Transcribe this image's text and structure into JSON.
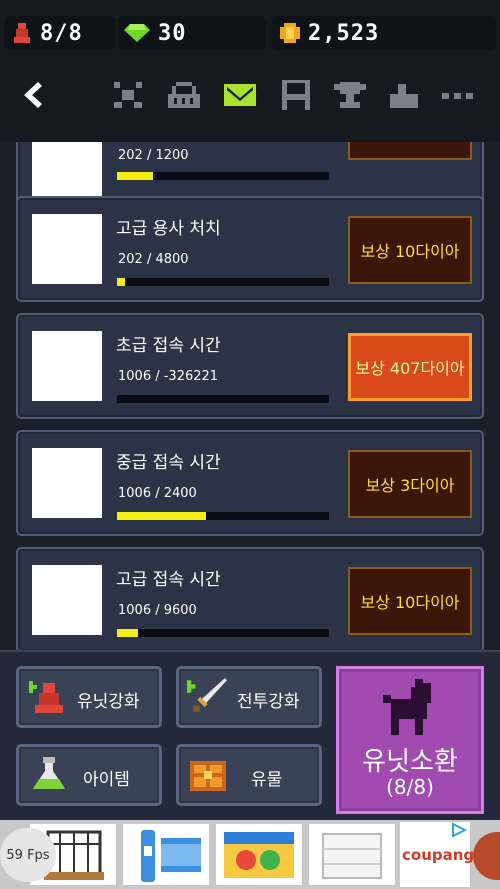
{
  "header": {
    "units_count": "8/8",
    "gems": "30",
    "gold": "2,523"
  },
  "nav": {
    "back_icon": "back-arrow-icon",
    "tabs": [
      "crossed-swords-icon",
      "shop-basket-icon",
      "mail-icon",
      "save-icon",
      "trophy-icon",
      "profile-icon",
      "more-icon"
    ],
    "active_tab": "mail-icon",
    "active_color": "#a6e22e"
  },
  "missions": [
    {
      "title": "",
      "progress_text": "202 / 1200",
      "progress": 0.17,
      "reward": ""
    },
    {
      "title": "고급 용사 처치",
      "progress_text": "202 / 4800",
      "progress": 0.04,
      "reward": "보상 10다이아"
    },
    {
      "title": "초급 접속 시간",
      "progress_text": "1006 / -326221",
      "progress": 0.0,
      "reward": "보상 407다이아",
      "active": true
    },
    {
      "title": "중급 접속 시간",
      "progress_text": "1006 / 2400",
      "progress": 0.42,
      "reward": "보상 3다이아"
    },
    {
      "title": "고급 접속 시간",
      "progress_text": "1006 / 9600",
      "progress": 0.1,
      "reward": "보상 10다이아"
    }
  ],
  "bottom": {
    "unit_upgrade": "유닛강화",
    "battle_upgrade": "전투강화",
    "item": "아이템",
    "relic": "유물",
    "summon": "유닛소환",
    "summon_count": "(8/8)"
  },
  "ad": {
    "fps": "59 Fps",
    "brand": "coupang"
  }
}
